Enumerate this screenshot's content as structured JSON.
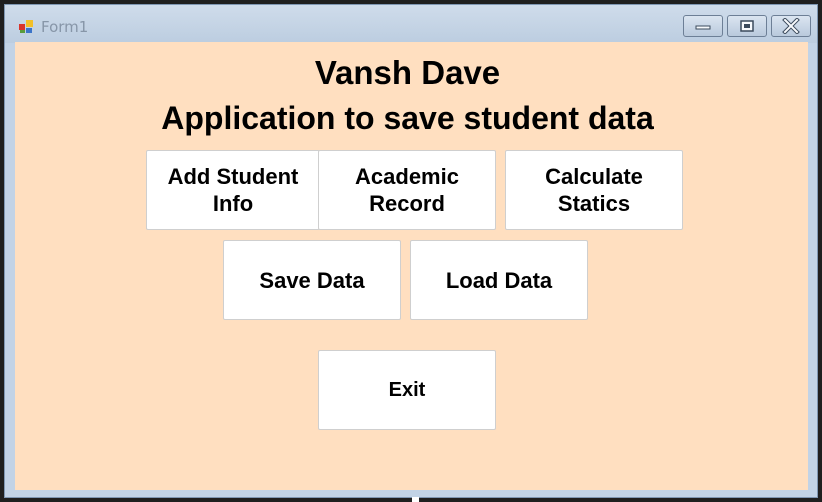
{
  "window": {
    "title": "Form1",
    "controls": {
      "minimize": "minimize",
      "maximize": "maximize",
      "close": "close"
    }
  },
  "form": {
    "name_heading": "Vansh Dave",
    "app_heading": "Application to save student data",
    "buttons": {
      "add_student_info": "Add Student\nInfo",
      "academic_record": "Academic\nRecord",
      "calculate_statics": "Calculate\nStatics",
      "save_data": "Save Data",
      "load_data": "Load Data",
      "exit": "Exit"
    }
  },
  "colors": {
    "form_background": "#ffdfc0",
    "titlebar": "#c2d3e6",
    "button_background": "#ffffff"
  }
}
